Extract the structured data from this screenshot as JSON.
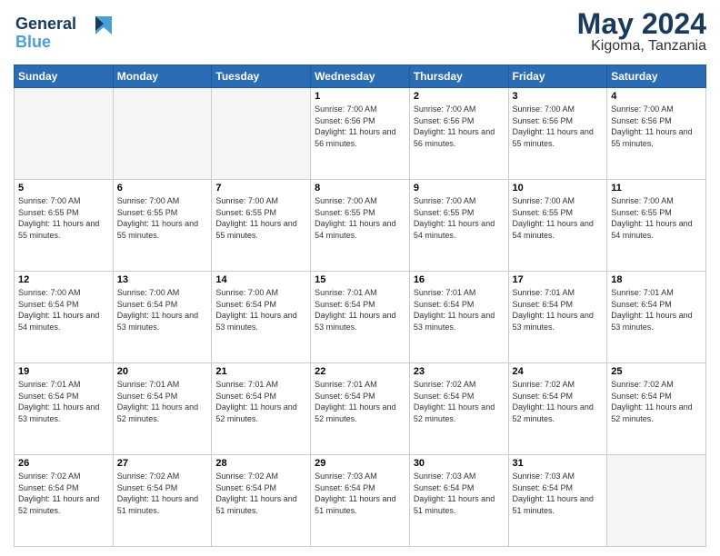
{
  "header": {
    "logo_line1": "General",
    "logo_line2": "Blue",
    "month_title": "May 2024",
    "location": "Kigoma, Tanzania"
  },
  "days_of_week": [
    "Sunday",
    "Monday",
    "Tuesday",
    "Wednesday",
    "Thursday",
    "Friday",
    "Saturday"
  ],
  "weeks": [
    [
      {
        "day": "",
        "empty": true
      },
      {
        "day": "",
        "empty": true
      },
      {
        "day": "",
        "empty": true
      },
      {
        "day": "1",
        "sunrise": "7:00 AM",
        "sunset": "6:56 PM",
        "daylight": "11 hours and 56 minutes."
      },
      {
        "day": "2",
        "sunrise": "7:00 AM",
        "sunset": "6:56 PM",
        "daylight": "11 hours and 56 minutes."
      },
      {
        "day": "3",
        "sunrise": "7:00 AM",
        "sunset": "6:56 PM",
        "daylight": "11 hours and 55 minutes."
      },
      {
        "day": "4",
        "sunrise": "7:00 AM",
        "sunset": "6:56 PM",
        "daylight": "11 hours and 55 minutes."
      }
    ],
    [
      {
        "day": "5",
        "sunrise": "7:00 AM",
        "sunset": "6:55 PM",
        "daylight": "11 hours and 55 minutes."
      },
      {
        "day": "6",
        "sunrise": "7:00 AM",
        "sunset": "6:55 PM",
        "daylight": "11 hours and 55 minutes."
      },
      {
        "day": "7",
        "sunrise": "7:00 AM",
        "sunset": "6:55 PM",
        "daylight": "11 hours and 55 minutes."
      },
      {
        "day": "8",
        "sunrise": "7:00 AM",
        "sunset": "6:55 PM",
        "daylight": "11 hours and 54 minutes."
      },
      {
        "day": "9",
        "sunrise": "7:00 AM",
        "sunset": "6:55 PM",
        "daylight": "11 hours and 54 minutes."
      },
      {
        "day": "10",
        "sunrise": "7:00 AM",
        "sunset": "6:55 PM",
        "daylight": "11 hours and 54 minutes."
      },
      {
        "day": "11",
        "sunrise": "7:00 AM",
        "sunset": "6:55 PM",
        "daylight": "11 hours and 54 minutes."
      }
    ],
    [
      {
        "day": "12",
        "sunrise": "7:00 AM",
        "sunset": "6:54 PM",
        "daylight": "11 hours and 54 minutes."
      },
      {
        "day": "13",
        "sunrise": "7:00 AM",
        "sunset": "6:54 PM",
        "daylight": "11 hours and 53 minutes."
      },
      {
        "day": "14",
        "sunrise": "7:00 AM",
        "sunset": "6:54 PM",
        "daylight": "11 hours and 53 minutes."
      },
      {
        "day": "15",
        "sunrise": "7:01 AM",
        "sunset": "6:54 PM",
        "daylight": "11 hours and 53 minutes."
      },
      {
        "day": "16",
        "sunrise": "7:01 AM",
        "sunset": "6:54 PM",
        "daylight": "11 hours and 53 minutes."
      },
      {
        "day": "17",
        "sunrise": "7:01 AM",
        "sunset": "6:54 PM",
        "daylight": "11 hours and 53 minutes."
      },
      {
        "day": "18",
        "sunrise": "7:01 AM",
        "sunset": "6:54 PM",
        "daylight": "11 hours and 53 minutes."
      }
    ],
    [
      {
        "day": "19",
        "sunrise": "7:01 AM",
        "sunset": "6:54 PM",
        "daylight": "11 hours and 53 minutes."
      },
      {
        "day": "20",
        "sunrise": "7:01 AM",
        "sunset": "6:54 PM",
        "daylight": "11 hours and 52 minutes."
      },
      {
        "day": "21",
        "sunrise": "7:01 AM",
        "sunset": "6:54 PM",
        "daylight": "11 hours and 52 minutes."
      },
      {
        "day": "22",
        "sunrise": "7:01 AM",
        "sunset": "6:54 PM",
        "daylight": "11 hours and 52 minutes."
      },
      {
        "day": "23",
        "sunrise": "7:02 AM",
        "sunset": "6:54 PM",
        "daylight": "11 hours and 52 minutes."
      },
      {
        "day": "24",
        "sunrise": "7:02 AM",
        "sunset": "6:54 PM",
        "daylight": "11 hours and 52 minutes."
      },
      {
        "day": "25",
        "sunrise": "7:02 AM",
        "sunset": "6:54 PM",
        "daylight": "11 hours and 52 minutes."
      }
    ],
    [
      {
        "day": "26",
        "sunrise": "7:02 AM",
        "sunset": "6:54 PM",
        "daylight": "11 hours and 52 minutes."
      },
      {
        "day": "27",
        "sunrise": "7:02 AM",
        "sunset": "6:54 PM",
        "daylight": "11 hours and 51 minutes."
      },
      {
        "day": "28",
        "sunrise": "7:02 AM",
        "sunset": "6:54 PM",
        "daylight": "11 hours and 51 minutes."
      },
      {
        "day": "29",
        "sunrise": "7:03 AM",
        "sunset": "6:54 PM",
        "daylight": "11 hours and 51 minutes."
      },
      {
        "day": "30",
        "sunrise": "7:03 AM",
        "sunset": "6:54 PM",
        "daylight": "11 hours and 51 minutes."
      },
      {
        "day": "31",
        "sunrise": "7:03 AM",
        "sunset": "6:54 PM",
        "daylight": "11 hours and 51 minutes."
      },
      {
        "day": "",
        "empty": true
      }
    ]
  ]
}
